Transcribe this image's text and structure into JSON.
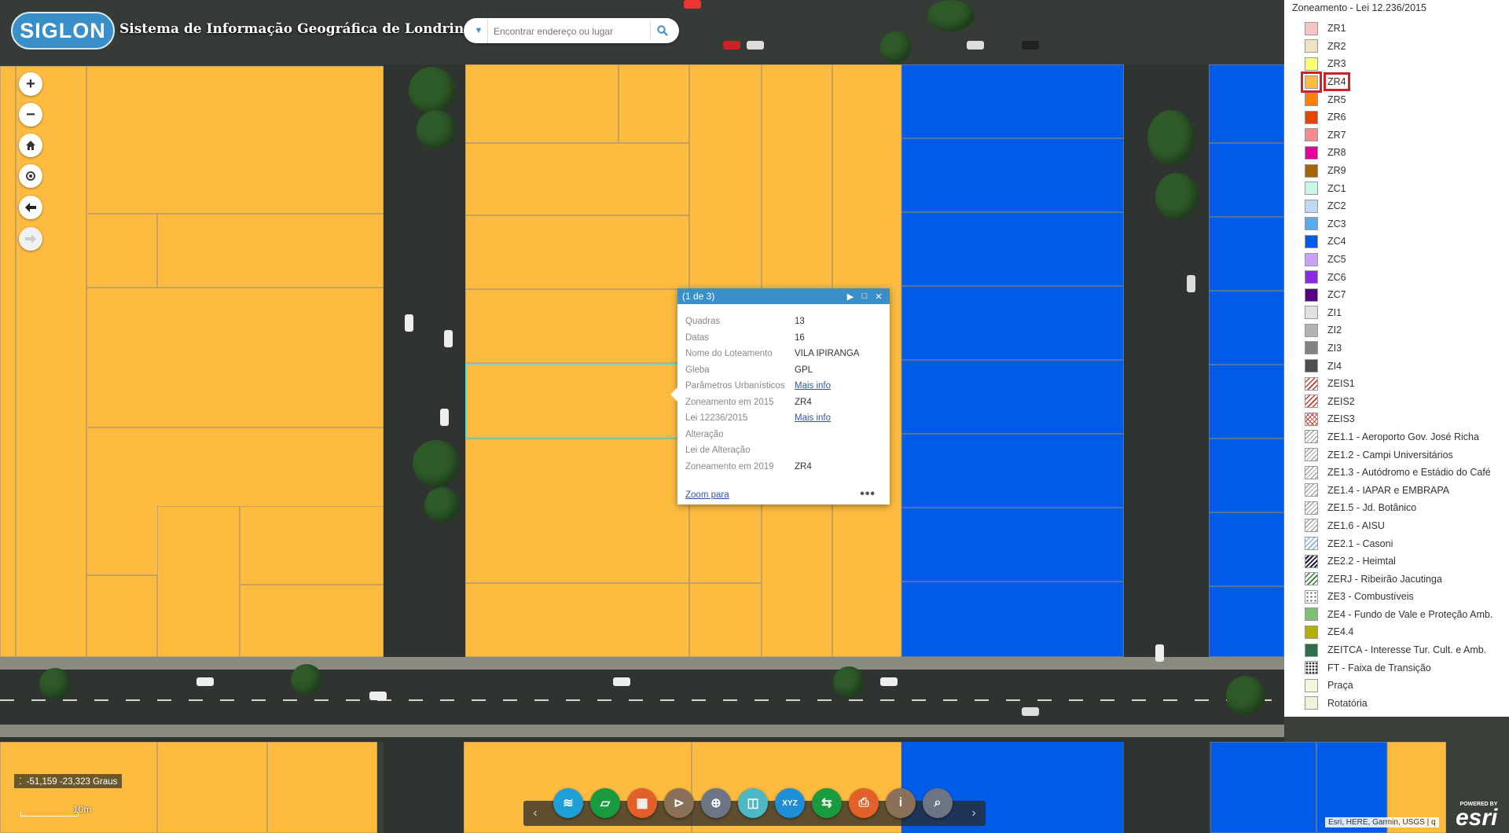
{
  "header": {
    "logo_text": "SIGLON",
    "title": "Sistema de Informação Geográfica de Londrina"
  },
  "search": {
    "placeholder": "Encontrar endereço ou lugar"
  },
  "popup": {
    "count": "(1 de 3)",
    "fields": [
      {
        "label": "Quadras",
        "value": "13"
      },
      {
        "label": "Datas",
        "value": "16"
      },
      {
        "label": "Nome do Loteamento",
        "value": "VILA IPIRANGA"
      },
      {
        "label": "Gleba",
        "value": "GPL"
      },
      {
        "label": "Parâmetros Urbanísticos",
        "link": "Mais info"
      },
      {
        "label": "Zoneamento em 2015",
        "value": "ZR4"
      },
      {
        "label": "Lei 12236/2015",
        "link": "Mais info"
      },
      {
        "label": "Alteração",
        "value": ""
      },
      {
        "label": "Lei de Alteração",
        "value": ""
      },
      {
        "label": "Zoneamento em 2019",
        "value": "ZR4"
      }
    ],
    "zoom_link": "Zoom para",
    "more": "•••"
  },
  "legend": {
    "title": "Zoneamento - Lei 12.236/2015",
    "selected": "ZR4",
    "items": [
      {
        "label": "ZR1",
        "color": "#f7c4c4"
      },
      {
        "label": "ZR2",
        "color": "#efe2c0"
      },
      {
        "label": "ZR3",
        "color": "#ffff73"
      },
      {
        "label": "ZR4",
        "color": "#fdbb40"
      },
      {
        "label": "ZR5",
        "color": "#ff7f00"
      },
      {
        "label": "ZR6",
        "color": "#e64500"
      },
      {
        "label": "ZR7",
        "color": "#f58a8a"
      },
      {
        "label": "ZR8",
        "color": "#e60099"
      },
      {
        "label": "ZR9",
        "color": "#a86400"
      },
      {
        "label": "ZC1",
        "color": "#c8f7e6"
      },
      {
        "label": "ZC2",
        "color": "#bed8f5"
      },
      {
        "label": "ZC3",
        "color": "#5aaaf0"
      },
      {
        "label": "ZC4",
        "color": "#005ce6"
      },
      {
        "label": "ZC5",
        "color": "#c8a0f5"
      },
      {
        "label": "ZC6",
        "color": "#8a2be2"
      },
      {
        "label": "ZC7",
        "color": "#5a0087"
      },
      {
        "label": "ZI1",
        "color": "#e1e1e1"
      },
      {
        "label": "ZI2",
        "color": "#b2b2b2"
      },
      {
        "label": "ZI3",
        "color": "#828282"
      },
      {
        "label": "ZI4",
        "color": "#4e4e4e"
      },
      {
        "label": "ZEIS1",
        "pattern": "hatch-red"
      },
      {
        "label": "ZEIS2",
        "pattern": "hatch-red"
      },
      {
        "label": "ZEIS3",
        "pattern": "cross-red"
      },
      {
        "label": "ZE1.1 - Aeroporto Gov. José Richa",
        "pattern": "hatch"
      },
      {
        "label": "ZE1.2 - Campi Universitários",
        "pattern": "hatch"
      },
      {
        "label": "ZE1.3 - Autódromo e Estádio do Café",
        "pattern": "hatch"
      },
      {
        "label": "ZE1.4 - IAPAR e EMBRAPA",
        "pattern": "hatch"
      },
      {
        "label": "ZE1.5 - Jd. Botânico",
        "pattern": "hatch"
      },
      {
        "label": "ZE1.6 - AISU",
        "pattern": "hatch"
      },
      {
        "label": "ZE2.1 - Casoni",
        "pattern": "hatch-lightblue"
      },
      {
        "label": "ZE2.2 - Heimtal",
        "pattern": "hatch-dark"
      },
      {
        "label": "ZERJ - Ribeirão Jacutinga",
        "pattern": "hatch-green"
      },
      {
        "label": "ZE3 - Combustíveis",
        "pattern": "dots"
      },
      {
        "label": "ZE4 - Fundo de Vale e Proteção Amb.",
        "color": "#7dbf74"
      },
      {
        "label": "ZE4.4",
        "color": "#b5b000"
      },
      {
        "label": "ZEITCA - Interesse Tur. Cult. e Amb.",
        "color": "#2d6e4f"
      },
      {
        "label": "FT - Faixa de Transição",
        "pattern": "dots-dark"
      },
      {
        "label": "Praça",
        "color": "#f2f7dc"
      },
      {
        "label": "Rotatória",
        "color": "#eef5d6"
      }
    ]
  },
  "coordinates": "-51,159 -23,323 Graus",
  "scale": "10m",
  "toolbar": {
    "tools": [
      {
        "name": "layers-tool",
        "color": "#1e9fd6",
        "glyph": "≋"
      },
      {
        "name": "measure-tool",
        "color": "#1a9a3e",
        "glyph": "▱"
      },
      {
        "name": "basemap-tool",
        "color": "#e2602a",
        "glyph": "▦"
      },
      {
        "name": "filter-tool",
        "color": "#8a7058",
        "glyph": "⊳"
      },
      {
        "name": "location-tool",
        "color": "#6d7585",
        "glyph": "⊕"
      },
      {
        "name": "swipe-tool",
        "color": "#4db7c4",
        "glyph": "◫"
      },
      {
        "name": "xyz-tool",
        "color": "#1e8fd6",
        "glyph": "XYZ"
      },
      {
        "name": "share-tool",
        "color": "#1a9a3e",
        "glyph": "⇆"
      },
      {
        "name": "print-tool",
        "color": "#e2602a",
        "glyph": "⎙"
      },
      {
        "name": "info-tool",
        "color": "#8a7058",
        "glyph": "i"
      },
      {
        "name": "query-tool",
        "color": "#6d7585",
        "glyph": "⌕"
      }
    ]
  },
  "attribution": "Esri, HERE, Garmin, USGS | q",
  "esri": {
    "powered": "POWERED BY",
    "brand": "esri"
  }
}
